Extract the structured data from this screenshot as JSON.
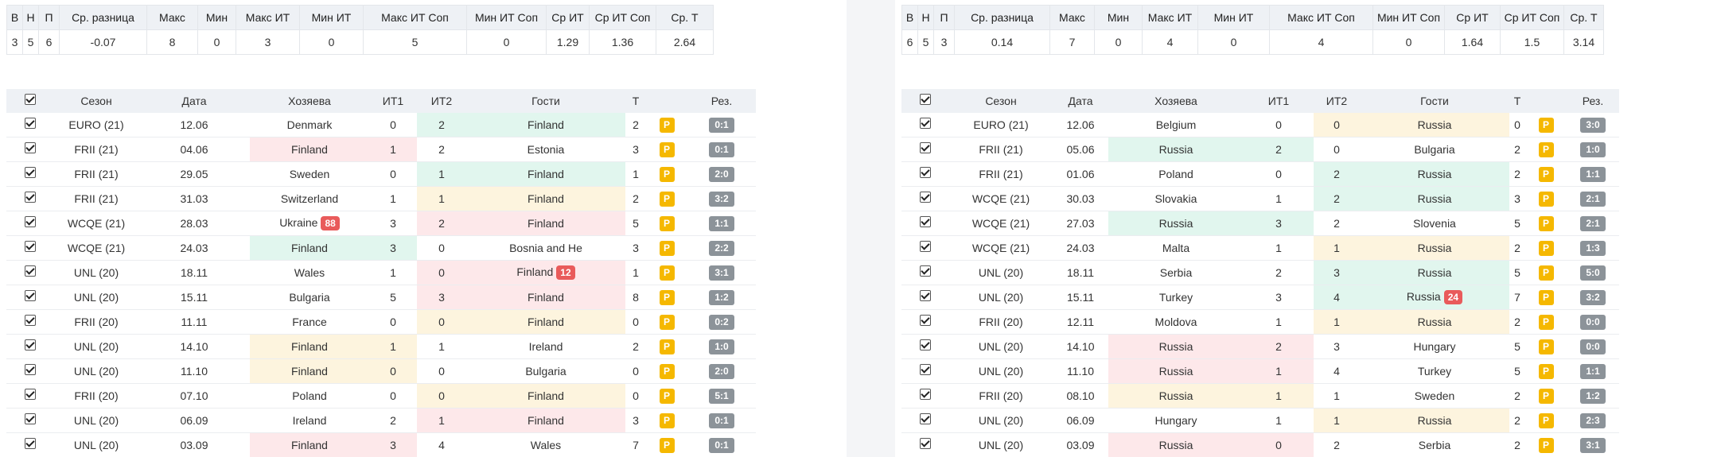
{
  "summary_headers": [
    "В",
    "Н",
    "П",
    "Ср. разница",
    "Макс",
    "Мин",
    "Макс ИТ",
    "Мин ИТ",
    "Макс ИТ Соп",
    "Мин ИТ Соп",
    "Ср ИТ",
    "Ср ИТ Соп",
    "Ср. Т"
  ],
  "match_headers": {
    "season": "Сезон",
    "date": "Дата",
    "home": "Хозяева",
    "it1": "ИТ1",
    "it2": "ИТ2",
    "away": "Гости",
    "t": "Т",
    "res": "Рез."
  },
  "p_label": "P",
  "colors": {
    "red_bg": "#fde8ea",
    "green_bg": "#e1f6ee",
    "yellow_bg": "#fdf4de",
    "p_badge": "#f5b800",
    "result_badge": "#8c9399",
    "count_badge": "#e95b5b"
  },
  "left": {
    "summary": [
      "3",
      "5",
      "6",
      "-0.07",
      "8",
      "0",
      "3",
      "0",
      "5",
      "0",
      "1.29",
      "1.36",
      "2.64"
    ],
    "rows": [
      {
        "season": "EURO (21)",
        "date": "12.06",
        "home": "Denmark",
        "it1": "0",
        "it2": "2",
        "away": "Finland",
        "t": "2",
        "res": "0:1",
        "home_c": "",
        "it1_c": "",
        "it2_c": "green",
        "away_c": "green",
        "badge": ""
      },
      {
        "season": "FRII (21)",
        "date": "04.06",
        "home": "Finland",
        "it1": "1",
        "it2": "2",
        "away": "Estonia",
        "t": "3",
        "res": "0:1",
        "home_c": "red",
        "it1_c": "red",
        "it2_c": "",
        "away_c": "",
        "badge": ""
      },
      {
        "season": "FRII (21)",
        "date": "29.05",
        "home": "Sweden",
        "it1": "0",
        "it2": "1",
        "away": "Finland",
        "t": "1",
        "res": "2:0",
        "home_c": "",
        "it1_c": "",
        "it2_c": "green",
        "away_c": "green",
        "badge": ""
      },
      {
        "season": "FRII (21)",
        "date": "31.03",
        "home": "Switzerland",
        "it1": "1",
        "it2": "1",
        "away": "Finland",
        "t": "2",
        "res": "3:2",
        "home_c": "",
        "it1_c": "",
        "it2_c": "yellow",
        "away_c": "yellow",
        "badge": ""
      },
      {
        "season": "WCQE (21)",
        "date": "28.03",
        "home": "Ukraine",
        "it1": "3",
        "it2": "2",
        "away": "Finland",
        "t": "5",
        "res": "1:1",
        "home_c": "",
        "it1_c": "",
        "it2_c": "red",
        "away_c": "red",
        "badge": "88",
        "badge_on": "home"
      },
      {
        "season": "WCQE (21)",
        "date": "24.03",
        "home": "Finland",
        "it1": "3",
        "it2": "0",
        "away": "Bosnia and He",
        "t": "3",
        "res": "2:2",
        "home_c": "green",
        "it1_c": "green",
        "it2_c": "",
        "away_c": "",
        "badge": ""
      },
      {
        "season": "UNL (20)",
        "date": "18.11",
        "home": "Wales",
        "it1": "1",
        "it2": "0",
        "away": "Finland",
        "t": "1",
        "res": "3:1",
        "home_c": "",
        "it1_c": "",
        "it2_c": "red",
        "away_c": "red",
        "badge": "12",
        "badge_on": "away"
      },
      {
        "season": "UNL (20)",
        "date": "15.11",
        "home": "Bulgaria",
        "it1": "5",
        "it2": "3",
        "away": "Finland",
        "t": "8",
        "res": "1:2",
        "home_c": "",
        "it1_c": "",
        "it2_c": "red",
        "away_c": "red",
        "badge": ""
      },
      {
        "season": "FRII (20)",
        "date": "11.11",
        "home": "France",
        "it1": "0",
        "it2": "0",
        "away": "Finland",
        "t": "0",
        "res": "0:2",
        "home_c": "",
        "it1_c": "",
        "it2_c": "yellow",
        "away_c": "yellow",
        "badge": ""
      },
      {
        "season": "UNL (20)",
        "date": "14.10",
        "home": "Finland",
        "it1": "1",
        "it2": "1",
        "away": "Ireland",
        "t": "2",
        "res": "1:0",
        "home_c": "yellow",
        "it1_c": "yellow",
        "it2_c": "",
        "away_c": "",
        "badge": ""
      },
      {
        "season": "UNL (20)",
        "date": "11.10",
        "home": "Finland",
        "it1": "0",
        "it2": "0",
        "away": "Bulgaria",
        "t": "0",
        "res": "2:0",
        "home_c": "yellow",
        "it1_c": "yellow",
        "it2_c": "",
        "away_c": "",
        "badge": ""
      },
      {
        "season": "FRII (20)",
        "date": "07.10",
        "home": "Poland",
        "it1": "0",
        "it2": "0",
        "away": "Finland",
        "t": "0",
        "res": "5:1",
        "home_c": "",
        "it1_c": "",
        "it2_c": "yellow",
        "away_c": "yellow",
        "badge": ""
      },
      {
        "season": "UNL (20)",
        "date": "06.09",
        "home": "Ireland",
        "it1": "2",
        "it2": "1",
        "away": "Finland",
        "t": "3",
        "res": "0:1",
        "home_c": "",
        "it1_c": "",
        "it2_c": "red",
        "away_c": "red",
        "badge": ""
      },
      {
        "season": "UNL (20)",
        "date": "03.09",
        "home": "Finland",
        "it1": "3",
        "it2": "4",
        "away": "Wales",
        "t": "7",
        "res": "0:1",
        "home_c": "red",
        "it1_c": "red",
        "it2_c": "",
        "away_c": "",
        "badge": ""
      }
    ]
  },
  "right": {
    "summary": [
      "6",
      "5",
      "3",
      "0.14",
      "7",
      "0",
      "4",
      "0",
      "4",
      "0",
      "1.64",
      "1.5",
      "3.14"
    ],
    "rows": [
      {
        "season": "EURO (21)",
        "date": "12.06",
        "home": "Belgium",
        "it1": "0",
        "it2": "0",
        "away": "Russia",
        "t": "0",
        "res": "3:0",
        "home_c": "",
        "it1_c": "",
        "it2_c": "yellow",
        "away_c": "yellow",
        "badge": ""
      },
      {
        "season": "FRII (21)",
        "date": "05.06",
        "home": "Russia",
        "it1": "2",
        "it2": "0",
        "away": "Bulgaria",
        "t": "2",
        "res": "1:0",
        "home_c": "green",
        "it1_c": "green",
        "it2_c": "",
        "away_c": "",
        "badge": ""
      },
      {
        "season": "FRII (21)",
        "date": "01.06",
        "home": "Poland",
        "it1": "0",
        "it2": "2",
        "away": "Russia",
        "t": "2",
        "res": "1:1",
        "home_c": "",
        "it1_c": "",
        "it2_c": "green",
        "away_c": "green",
        "badge": ""
      },
      {
        "season": "WCQE (21)",
        "date": "30.03",
        "home": "Slovakia",
        "it1": "1",
        "it2": "2",
        "away": "Russia",
        "t": "3",
        "res": "2:1",
        "home_c": "",
        "it1_c": "",
        "it2_c": "green",
        "away_c": "green",
        "badge": ""
      },
      {
        "season": "WCQE (21)",
        "date": "27.03",
        "home": "Russia",
        "it1": "3",
        "it2": "2",
        "away": "Slovenia",
        "t": "5",
        "res": "2:1",
        "home_c": "green",
        "it1_c": "green",
        "it2_c": "",
        "away_c": "",
        "badge": ""
      },
      {
        "season": "WCQE (21)",
        "date": "24.03",
        "home": "Malta",
        "it1": "1",
        "it2": "1",
        "away": "Russia",
        "t": "2",
        "res": "1:3",
        "home_c": "",
        "it1_c": "",
        "it2_c": "yellow",
        "away_c": "yellow",
        "badge": ""
      },
      {
        "season": "UNL (20)",
        "date": "18.11",
        "home": "Serbia",
        "it1": "2",
        "it2": "3",
        "away": "Russia",
        "t": "5",
        "res": "5:0",
        "home_c": "",
        "it1_c": "",
        "it2_c": "green",
        "away_c": "green",
        "badge": ""
      },
      {
        "season": "UNL (20)",
        "date": "15.11",
        "home": "Turkey",
        "it1": "3",
        "it2": "4",
        "away": "Russia",
        "t": "7",
        "res": "3:2",
        "home_c": "",
        "it1_c": "",
        "it2_c": "green",
        "away_c": "green",
        "badge": "24",
        "badge_on": "away"
      },
      {
        "season": "FRII (20)",
        "date": "12.11",
        "home": "Moldova",
        "it1": "1",
        "it2": "1",
        "away": "Russia",
        "t": "2",
        "res": "0:0",
        "home_c": "",
        "it1_c": "",
        "it2_c": "yellow",
        "away_c": "yellow",
        "badge": ""
      },
      {
        "season": "UNL (20)",
        "date": "14.10",
        "home": "Russia",
        "it1": "2",
        "it2": "3",
        "away": "Hungary",
        "t": "5",
        "res": "0:0",
        "home_c": "red",
        "it1_c": "red",
        "it2_c": "",
        "away_c": "",
        "badge": ""
      },
      {
        "season": "UNL (20)",
        "date": "11.10",
        "home": "Russia",
        "it1": "1",
        "it2": "4",
        "away": "Turkey",
        "t": "5",
        "res": "1:1",
        "home_c": "red",
        "it1_c": "red",
        "it2_c": "",
        "away_c": "",
        "badge": ""
      },
      {
        "season": "FRII (20)",
        "date": "08.10",
        "home": "Russia",
        "it1": "1",
        "it2": "1",
        "away": "Sweden",
        "t": "2",
        "res": "1:2",
        "home_c": "yellow",
        "it1_c": "yellow",
        "it2_c": "",
        "away_c": "",
        "badge": ""
      },
      {
        "season": "UNL (20)",
        "date": "06.09",
        "home": "Hungary",
        "it1": "1",
        "it2": "1",
        "away": "Russia",
        "t": "2",
        "res": "2:3",
        "home_c": "",
        "it1_c": "",
        "it2_c": "yellow",
        "away_c": "yellow",
        "badge": ""
      },
      {
        "season": "UNL (20)",
        "date": "03.09",
        "home": "Russia",
        "it1": "0",
        "it2": "2",
        "away": "Serbia",
        "t": "2",
        "res": "3:1",
        "home_c": "red",
        "it1_c": "red",
        "it2_c": "",
        "away_c": "",
        "badge": ""
      }
    ]
  }
}
